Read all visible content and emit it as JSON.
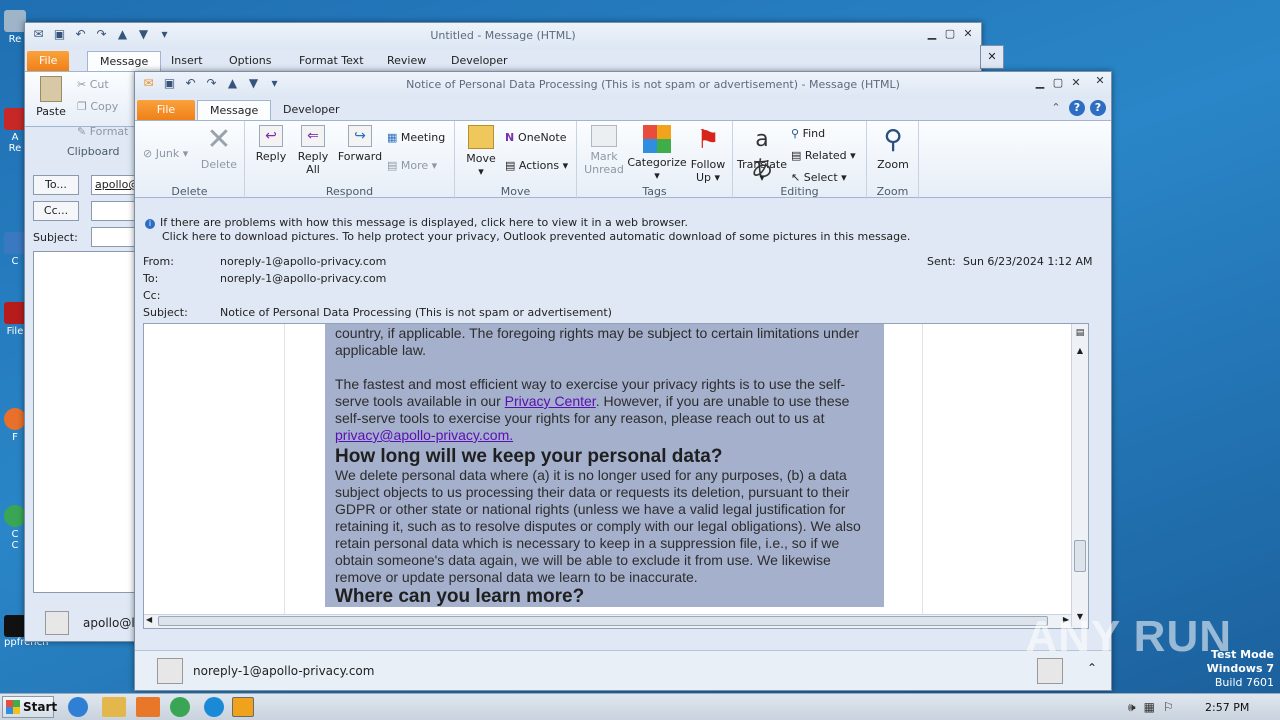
{
  "desktop": {
    "icons": [
      "Re",
      "A",
      "Re",
      "C",
      "File",
      "F",
      "C",
      "C",
      "ppfrench"
    ],
    "watermark": "ANY RUN",
    "test_mode": {
      "line1": "Test Mode",
      "line2": "Windows 7",
      "line3": "Build 7601"
    }
  },
  "back_window": {
    "title": "Untitled - Message (HTML)",
    "tabs": [
      "File",
      "Message",
      "Insert",
      "Options",
      "Format Text",
      "Review",
      "Developer"
    ],
    "clipboard": {
      "paste": "Paste",
      "cut": "Cut",
      "copy": "Copy",
      "format": "Format",
      "group": "Clipboard"
    },
    "to_btn": "To...",
    "cc_btn": "Cc...",
    "subject_label": "Subject:",
    "to_value": "apollo@",
    "footer_name": "apollo@li"
  },
  "front_window": {
    "title": "Notice of Personal Data Processing (This is not spam or advertisement)  -  Message (HTML)",
    "tabs": [
      "File",
      "Message",
      "Developer"
    ],
    "ribbon": {
      "delete_group": {
        "junk": "Junk",
        "delete": "Delete",
        "label": "Delete"
      },
      "respond_group": {
        "reply": "Reply",
        "reply_all_1": "Reply",
        "reply_all_2": "All",
        "forward": "Forward",
        "meeting": "Meeting",
        "more": "More",
        "label": "Respond"
      },
      "move_group": {
        "move": "Move",
        "onenote": "OneNote",
        "actions": "Actions",
        "label": "Move"
      },
      "tags_group": {
        "mark_1": "Mark",
        "mark_2": "Unread",
        "categorize": "Categorize",
        "follow_1": "Follow",
        "follow_2": "Up",
        "label": "Tags"
      },
      "editing_group": {
        "translate": "Translate",
        "find": "Find",
        "related": "Related",
        "select": "Select",
        "label": "Editing"
      },
      "zoom_group": {
        "zoom": "Zoom",
        "label": "Zoom"
      }
    },
    "infobar": {
      "line1": "If there are problems with how this message is displayed, click here to view it in a web browser.",
      "line2": "Click here to download pictures. To help protect your privacy, Outlook prevented automatic download of some pictures in this message."
    },
    "header": {
      "from_label": "From:",
      "from": "noreply-1@apollo-privacy.com",
      "to_label": "To:",
      "to": "noreply-1@apollo-privacy.com",
      "cc_label": "Cc:",
      "subject_label": "Subject:",
      "subject": "Notice of Personal Data Processing (This is not spam or advertisement)",
      "sent_label": "Sent:",
      "sent": "Sun 6/23/2024 1:12 AM"
    },
    "body": {
      "p0": "country, if applicable. The foregoing rights may be subject to certain limitations under applicable law.",
      "p1_a": "The fastest and most efficient way to exercise your privacy rights is to use the self-serve tools available in our ",
      "p1_link": "Privacy Center",
      "p1_b": ". However, if you are unable to use these self-serve tools to exercise your rights for any reason, please reach out to us at ",
      "p1_email": "privacy@apollo-privacy.com.",
      "h_keep": "How long will we keep your personal data?",
      "p2": "We delete personal data where (a) it is no longer used for any purposes, (b) a data subject objects to us processing their data or requests its deletion, pursuant to their GDPR or other state or national rights (unless we have a valid legal justification for retaining it, such as to resolve disputes or comply with our legal obligations). We also retain personal data which is necessary to keep in a suppression file, i.e., so if we obtain someone's data again, we will be able to exclude it from use. We likewise remove or update personal data we learn to be inaccurate.",
      "h_learn": "Where can you learn more?"
    },
    "people_pane": {
      "name": "noreply-1@apollo-privacy.com"
    }
  },
  "taskbar": {
    "start": "Start",
    "time": "2:57 PM"
  }
}
